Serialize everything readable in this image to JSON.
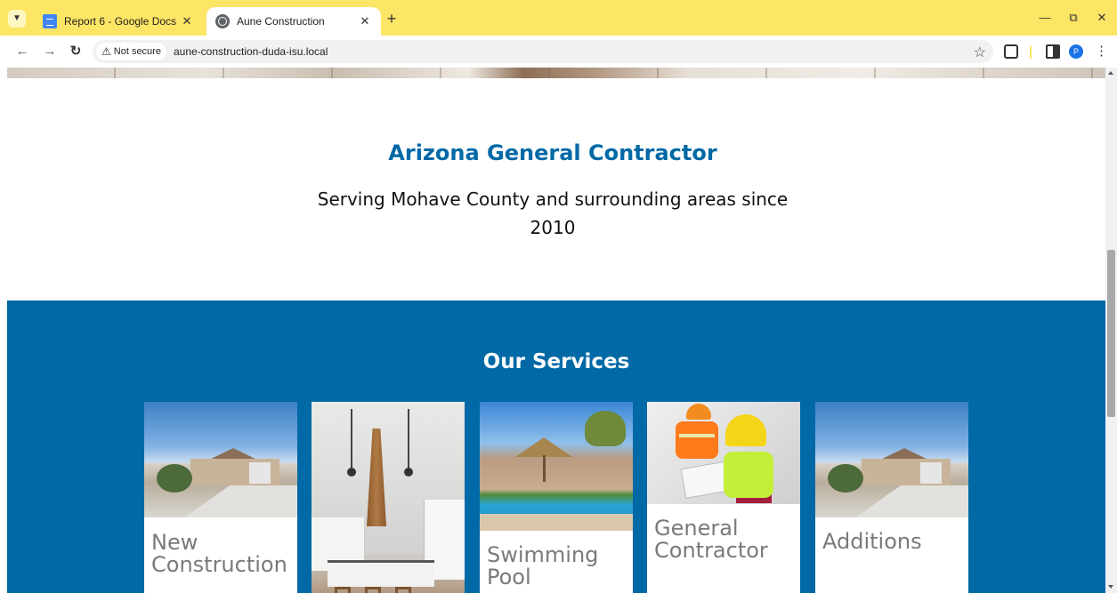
{
  "browser": {
    "tabs": [
      {
        "title": "Report 6 - Google Docs",
        "active": false,
        "icon": "google-docs-icon"
      },
      {
        "title": "Aune Construction",
        "active": true,
        "icon": "globe-icon"
      }
    ],
    "new_tab_glyph": "+",
    "security_label": "Not secure",
    "url": "aune-construction-duda-isu.local",
    "profile_initial": "P",
    "accent": "#fde565"
  },
  "page": {
    "intro": {
      "title": "Arizona General Contractor",
      "subtitle": "Serving Mohave County and surrounding areas since 2010"
    },
    "services": {
      "heading": "Our Services",
      "cards": [
        {
          "label": "New Construction",
          "image": "house-photo"
        },
        {
          "label": "",
          "image": "kitchen-photo"
        },
        {
          "label": "Swimming Pool",
          "image": "pool-photo"
        },
        {
          "label": "General Contractor",
          "image": "workers-photo"
        },
        {
          "label": "Additions",
          "image": "house-photo"
        }
      ]
    },
    "colors": {
      "brand_blue": "#0069a6",
      "card_text": "#7a7a7a"
    }
  }
}
